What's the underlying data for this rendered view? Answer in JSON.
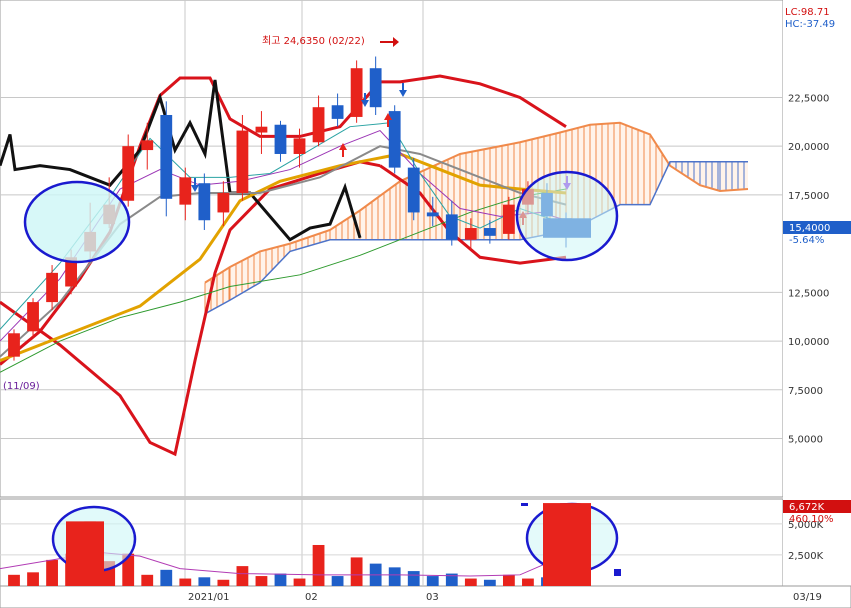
{
  "chart_data": {
    "type": "candlestick",
    "price_axis": {
      "ticks": [
        "22,5000",
        "20,0000",
        "17,5000",
        "15,4000",
        "12,5000",
        "10,0000",
        "7,5000",
        "5,0000"
      ],
      "tick_values": [
        22.5,
        20.0,
        17.5,
        15.4,
        12.5,
        10.0,
        7.5,
        5.0
      ],
      "ylim": [
        2.0,
        27.5
      ]
    },
    "volume_axis": {
      "ticks": [
        "5,000K",
        "2,500K"
      ],
      "tick_values": [
        5000,
        2500
      ],
      "ylim": [
        0,
        7000
      ]
    },
    "date_labels": [
      "2021/01",
      "02",
      "03",
      "03/19"
    ],
    "badges": {
      "lc": "LC:98.71",
      "hc": "HC:-37.49",
      "current_price": "15,4000",
      "change_pct": "-5.64%",
      "volume_current": "6,672K",
      "volume_pct": "460.10%"
    },
    "annotations": {
      "high": "최고 24,6350 (02/22)",
      "low_date": "(11/09)"
    },
    "candles": [
      {
        "o": 9.2,
        "h": 10.6,
        "l": 9.0,
        "c": 10.4,
        "v": 900
      },
      {
        "o": 10.5,
        "h": 12.2,
        "l": 10.2,
        "c": 12.0,
        "v": 1100
      },
      {
        "o": 12.0,
        "h": 13.9,
        "l": 11.6,
        "c": 13.5,
        "v": 2100
      },
      {
        "o": 12.8,
        "h": 14.7,
        "l": 12.4,
        "c": 14.3,
        "v": 2600
      },
      {
        "o": 14.6,
        "h": 17.1,
        "l": 14.2,
        "c": 15.6,
        "v": 5200
      },
      {
        "o": 16.0,
        "h": 18.4,
        "l": 15.8,
        "c": 17.0,
        "v": 2000
      },
      {
        "o": 17.2,
        "h": 20.6,
        "l": 16.9,
        "c": 20.0,
        "v": 2600
      },
      {
        "o": 19.8,
        "h": 21.2,
        "l": 18.8,
        "c": 20.3,
        "v": 900
      },
      {
        "o": 21.6,
        "h": 22.3,
        "l": 16.4,
        "c": 17.3,
        "v": 1300
      },
      {
        "o": 17.0,
        "h": 18.9,
        "l": 16.2,
        "c": 18.4,
        "v": 600
      },
      {
        "o": 18.1,
        "h": 18.6,
        "l": 15.7,
        "c": 16.2,
        "v": 700
      },
      {
        "o": 16.6,
        "h": 18.2,
        "l": 15.9,
        "c": 17.6,
        "v": 500
      },
      {
        "o": 17.6,
        "h": 21.6,
        "l": 17.2,
        "c": 20.8,
        "v": 1600
      },
      {
        "o": 20.7,
        "h": 21.8,
        "l": 19.6,
        "c": 21.0,
        "v": 800
      },
      {
        "o": 21.1,
        "h": 21.3,
        "l": 19.2,
        "c": 19.6,
        "v": 1000
      },
      {
        "o": 19.6,
        "h": 20.9,
        "l": 18.9,
        "c": 20.4,
        "v": 600
      },
      {
        "o": 20.2,
        "h": 22.6,
        "l": 20.0,
        "c": 22.0,
        "v": 3300
      },
      {
        "o": 22.1,
        "h": 22.7,
        "l": 21.0,
        "c": 21.4,
        "v": 800
      },
      {
        "o": 21.5,
        "h": 24.4,
        "l": 21.2,
        "c": 24.0,
        "v": 2300
      },
      {
        "o": 24.0,
        "h": 24.6,
        "l": 21.6,
        "c": 22.0,
        "v": 1800
      },
      {
        "o": 21.8,
        "h": 22.1,
        "l": 18.6,
        "c": 18.9,
        "v": 1500
      },
      {
        "o": 18.9,
        "h": 19.4,
        "l": 16.2,
        "c": 16.6,
        "v": 1200
      },
      {
        "o": 16.6,
        "h": 17.4,
        "l": 15.9,
        "c": 16.4,
        "v": 800
      },
      {
        "o": 16.5,
        "h": 17.2,
        "l": 14.9,
        "c": 15.2,
        "v": 1000
      },
      {
        "o": 15.2,
        "h": 16.3,
        "l": 14.7,
        "c": 15.8,
        "v": 600
      },
      {
        "o": 15.8,
        "h": 16.2,
        "l": 15.0,
        "c": 15.4,
        "v": 500
      },
      {
        "o": 15.5,
        "h": 17.4,
        "l": 15.2,
        "c": 17.0,
        "v": 900
      },
      {
        "o": 17.0,
        "h": 18.2,
        "l": 16.5,
        "c": 17.8,
        "v": 600
      },
      {
        "o": 17.6,
        "h": 18.1,
        "l": 16.0,
        "c": 16.4,
        "v": 700
      },
      {
        "o": 16.3,
        "h": 16.6,
        "l": 14.8,
        "c": 15.4,
        "v": 6672
      }
    ]
  },
  "colors": {
    "up": "#e8231c",
    "down": "#1f5fc9",
    "bollinger": "#d9131b",
    "price_line": "#111111",
    "cloud_a": "#f08a4b",
    "cloud_b": "#4d73c9",
    "highlight": "#1a1acf",
    "highlight_fill": "#cdf6f6"
  }
}
